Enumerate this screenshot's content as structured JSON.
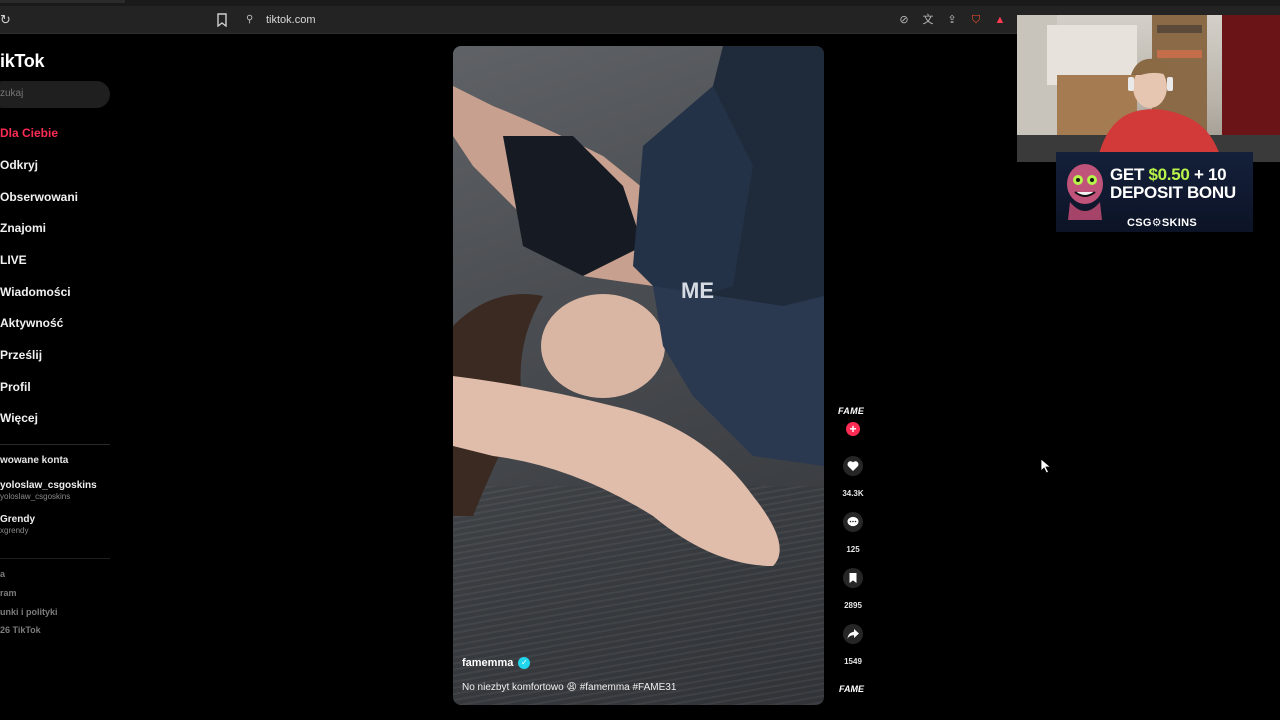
{
  "browser": {
    "url": "tiktok.com",
    "icons": [
      "reload-icon",
      "bookmark-icon",
      "site-info-icon",
      "no-tracking-icon",
      "translate-icon",
      "share-icon",
      "brave-shield-icon",
      "warning-triangle-icon"
    ]
  },
  "sidebar": {
    "logo": "ikTok",
    "search_placeholder": "zukaj",
    "nav": [
      {
        "label": "Dla Ciebie",
        "active": true
      },
      {
        "label": "Odkryj"
      },
      {
        "label": "Obserwowani"
      },
      {
        "label": "Znajomi"
      },
      {
        "label": "LIVE"
      },
      {
        "label": "Wiadomości"
      },
      {
        "label": "Aktywność"
      },
      {
        "label": "Prześlij"
      },
      {
        "label": "Profil"
      },
      {
        "label": "Więcej"
      }
    ],
    "following_title": "wowane konta",
    "accounts": [
      {
        "name": "yoloslaw_csgoskins",
        "handle": "yoloslaw_csgoskins"
      },
      {
        "name": "Grendy",
        "handle": "xgrendy"
      }
    ],
    "footer": [
      "a",
      "ram",
      "unki i polityki",
      "26 TikTok"
    ]
  },
  "video": {
    "author": "famemma",
    "caption": "No niezbyt komfortowo 😩 #famemma #FAME31",
    "actions": {
      "avatar_label": "FAME",
      "likes": "34.3K",
      "comments": "125",
      "saves": "2895",
      "shares": "1549",
      "bottom_label": "FAME"
    }
  },
  "ad": {
    "line1_prefix": "GET ",
    "line1_amount": "$0.50",
    "line1_suffix": " + 10",
    "line2": "DEPOSIT BONU",
    "brand": "CSG⚙SKINS"
  },
  "colors": {
    "accent": "#fe2c55",
    "verified": "#20d5ec",
    "ad_highlight": "#b7f34a"
  }
}
